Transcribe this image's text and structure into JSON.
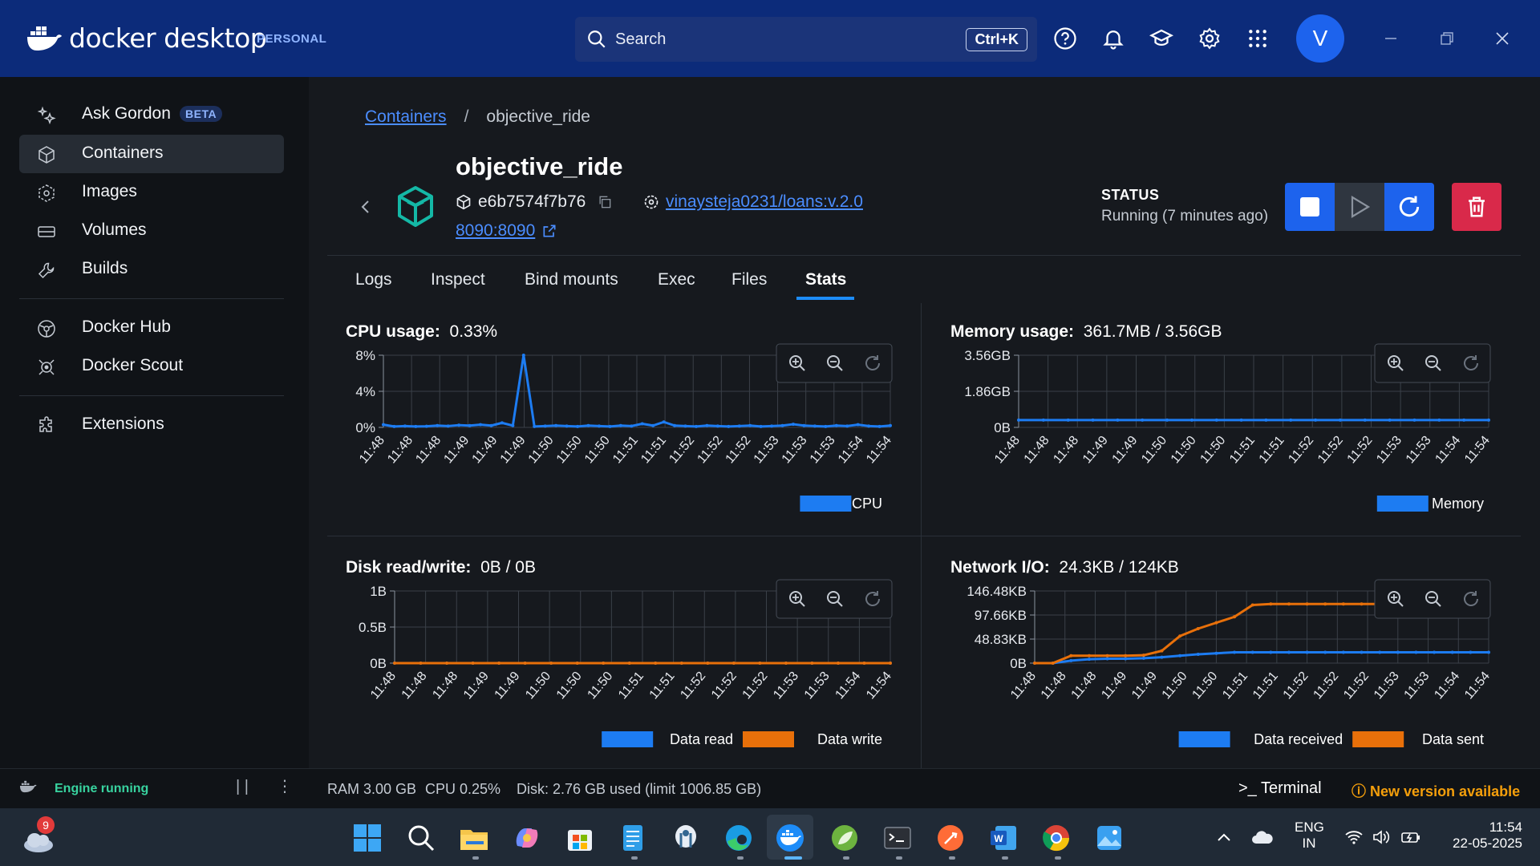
{
  "app": {
    "name": "docker desktop",
    "edition": "PERSONAL"
  },
  "search": {
    "placeholder": "Search",
    "shortcut": "Ctrl+K"
  },
  "user": {
    "initial": "V"
  },
  "sidebar": {
    "items": [
      {
        "label": "Ask Gordon",
        "badge": "BETA",
        "icon": "sparkle-icon"
      },
      {
        "label": "Containers",
        "icon": "container-icon",
        "active": true
      },
      {
        "label": "Images",
        "icon": "image-icon"
      },
      {
        "label": "Volumes",
        "icon": "volume-icon"
      },
      {
        "label": "Builds",
        "icon": "wrench-icon"
      },
      {
        "label": "Docker Hub",
        "icon": "hub-icon"
      },
      {
        "label": "Docker Scout",
        "icon": "scout-icon"
      },
      {
        "label": "Extensions",
        "icon": "puzzle-icon"
      }
    ]
  },
  "breadcrumb": {
    "parent": "Containers",
    "separator": "/",
    "current": "objective_ride"
  },
  "container": {
    "name": "objective_ride",
    "id": "e6b7574f7b76",
    "image": "vinaysteja0231/loans:v.2.0",
    "port": "8090:8090",
    "status_label": "STATUS",
    "status_value": "Running (7 minutes ago)"
  },
  "tabs": [
    "Logs",
    "Inspect",
    "Bind mounts",
    "Exec",
    "Files",
    "Stats"
  ],
  "active_tab": "Stats",
  "panels": {
    "cpu": {
      "label": "CPU usage:",
      "value": "0.33%"
    },
    "memory": {
      "label": "Memory usage:",
      "value": "361.7MB / 3.56GB"
    },
    "disk": {
      "label": "Disk read/write:",
      "value": "0B / 0B"
    },
    "network": {
      "label": "Network I/O:",
      "value": "24.3KB / 124KB"
    }
  },
  "chart_data": [
    {
      "type": "line",
      "title": "CPU usage",
      "yticks": [
        "8%",
        "4%",
        "0%"
      ],
      "ylim": [
        0,
        8
      ],
      "x": [
        "11:48",
        "11:48",
        "11:48",
        "11:49",
        "11:49",
        "11:49",
        "11:50",
        "11:50",
        "11:50",
        "11:51",
        "11:51",
        "11:52",
        "11:52",
        "11:52",
        "11:53",
        "11:53",
        "11:53",
        "11:54",
        "11:54"
      ],
      "series": [
        {
          "name": "CPU",
          "color": "#1d7cf2",
          "values": [
            0.3,
            0.1,
            0.15,
            0.1,
            0.12,
            0.2,
            0.15,
            0.25,
            0.2,
            0.3,
            0.2,
            0.5,
            0.2,
            8.0,
            0.1,
            0.15,
            0.2,
            0.15,
            0.1,
            0.2,
            0.15,
            0.1,
            0.2,
            0.15,
            0.4,
            0.2,
            0.6,
            0.2,
            0.15,
            0.1,
            0.2,
            0.15,
            0.1,
            0.15,
            0.2,
            0.1,
            0.15,
            0.2,
            0.35,
            0.2,
            0.15,
            0.1,
            0.2,
            0.15,
            0.3,
            0.15,
            0.1,
            0.2
          ]
        }
      ],
      "legend": [
        "CPU"
      ]
    },
    {
      "type": "line",
      "title": "Memory usage",
      "yticks": [
        "3.56GB",
        "1.86GB",
        "0B"
      ],
      "ylim": [
        0,
        3.56
      ],
      "x": [
        "11:48",
        "11:48",
        "11:48",
        "11:49",
        "11:49",
        "11:50",
        "11:50",
        "11:50",
        "11:51",
        "11:51",
        "11:52",
        "11:52",
        "11:52",
        "11:53",
        "11:53",
        "11:54",
        "11:54"
      ],
      "series": [
        {
          "name": "Memory",
          "color": "#1d7cf2",
          "values": [
            0.36,
            0.36,
            0.36,
            0.36,
            0.36,
            0.36,
            0.36,
            0.36,
            0.36,
            0.36,
            0.36,
            0.36,
            0.36,
            0.36,
            0.36,
            0.36,
            0.36,
            0.36,
            0.36,
            0.36
          ]
        }
      ],
      "legend": [
        "Memory"
      ]
    },
    {
      "type": "line",
      "title": "Disk read/write",
      "yticks": [
        "1B",
        "0.5B",
        "0B"
      ],
      "ylim": [
        0,
        1
      ],
      "x": [
        "11:48",
        "11:48",
        "11:48",
        "11:49",
        "11:49",
        "11:50",
        "11:50",
        "11:50",
        "11:51",
        "11:51",
        "11:52",
        "11:52",
        "11:52",
        "11:53",
        "11:53",
        "11:54",
        "11:54"
      ],
      "series": [
        {
          "name": "Data read",
          "color": "#1d7cf2",
          "values": [
            0,
            0,
            0,
            0,
            0,
            0,
            0,
            0,
            0,
            0,
            0,
            0,
            0,
            0,
            0,
            0,
            0,
            0,
            0,
            0
          ]
        },
        {
          "name": "Data write",
          "color": "#e8700a",
          "values": [
            0,
            0,
            0,
            0,
            0,
            0,
            0,
            0,
            0,
            0,
            0,
            0,
            0,
            0,
            0,
            0,
            0,
            0,
            0,
            0
          ]
        }
      ],
      "legend": [
        "Data read",
        "Data write"
      ]
    },
    {
      "type": "line",
      "title": "Network I/O",
      "yticks": [
        "146.48KB",
        "97.66KB",
        "48.83KB",
        "0B"
      ],
      "ylim": [
        0,
        146.48
      ],
      "x": [
        "11:48",
        "11:48",
        "11:48",
        "11:49",
        "11:49",
        "11:50",
        "11:50",
        "11:51",
        "11:51",
        "11:52",
        "11:52",
        "11:52",
        "11:53",
        "11:53",
        "11:54",
        "11:54"
      ],
      "series": [
        {
          "name": "Data received",
          "color": "#1d7cf2",
          "values": [
            0,
            0,
            5,
            8,
            9,
            9,
            10,
            12,
            15,
            18,
            20,
            22,
            22,
            22,
            22,
            22,
            22,
            22,
            22,
            22,
            22,
            22,
            22,
            22,
            22,
            22
          ]
        },
        {
          "name": "Data sent",
          "color": "#e8700a",
          "values": [
            0,
            0,
            15,
            15,
            15,
            15,
            16,
            25,
            55,
            70,
            82,
            94,
            118,
            120,
            120,
            120,
            120,
            120,
            120,
            120,
            120,
            120,
            120,
            120,
            120,
            120
          ]
        }
      ],
      "legend": [
        "Data received",
        "Data sent"
      ]
    }
  ],
  "statusbar": {
    "engine": "Engine running",
    "ram": "RAM 3.00 GB",
    "cpu": "CPU 0.25%",
    "disk": "Disk: 2.76 GB used (limit 1006.85 GB)",
    "terminal": "Terminal",
    "update": "New version available"
  },
  "taskbar": {
    "weather_badge": "9",
    "lang": "ENG",
    "region": "IN",
    "time": "11:54",
    "date": "22-05-2025"
  }
}
